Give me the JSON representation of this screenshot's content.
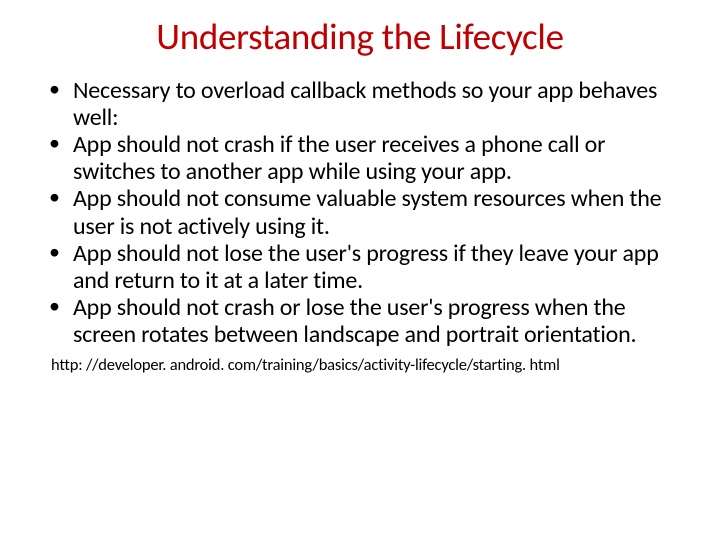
{
  "title": "Understanding the Lifecycle",
  "bullets": [
    "Necessary to overload callback methods so your app behaves well:",
    "App should not crash if the user receives a phone call or switches to another app while using your app.",
    "App should not consume valuable system resources when the user is not actively using it.",
    "App should not lose the user's progress if they leave your app and return to it at a later time.",
    "App should not crash or lose the user's progress when the screen rotates between landscape and portrait orientation."
  ],
  "footer": "http: //developer. android. com/training/basics/activity-lifecycle/starting. html"
}
